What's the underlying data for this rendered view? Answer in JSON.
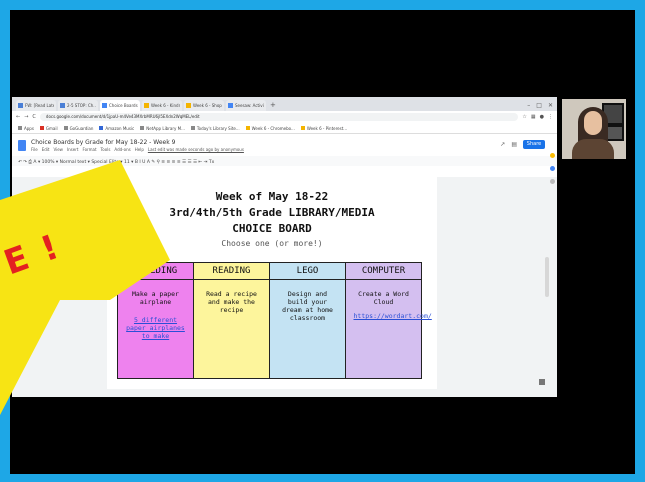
{
  "tabs": [
    {
      "label": "FW: [Read Later] Fw...",
      "active": false,
      "icon": "mail-icon"
    },
    {
      "label": "2-5 STOP: Ch...",
      "active": false,
      "icon": "doc-icon"
    },
    {
      "label": "Choice Boards by Gra...",
      "active": true,
      "icon": "docs-icon"
    },
    {
      "label": "Week 6 - Kindness Cl...",
      "active": false,
      "icon": "folder-icon"
    },
    {
      "label": "Week 6 - Shop the Li...",
      "active": false,
      "icon": "folder-icon"
    },
    {
      "label": "Seesaw: Activity Libr...",
      "active": false,
      "icon": "docs-icon"
    }
  ],
  "address": {
    "url": "docs.google.com/document/d/1jpaU-m4Ve43MXrbMRU6jI5EXdn2WqMEL/edit",
    "nav_back": "←",
    "nav_forward": "→",
    "reload": "C"
  },
  "bookmarks": [
    {
      "label": "Apps"
    },
    {
      "label": "Gmail"
    },
    {
      "label": "GoGuardian"
    },
    {
      "label": "Amazon Music"
    },
    {
      "label": "NetApp Library M..."
    },
    {
      "label": "Today's Library Site..."
    },
    {
      "label": "Week 6 - Chromebo..."
    },
    {
      "label": "Week 6 - Pinterest..."
    }
  ],
  "doc": {
    "title": "Choice Boards by Grade for May 18-22 - Week 9",
    "menus": [
      "File",
      "Edit",
      "View",
      "Insert",
      "Format",
      "Tools",
      "Add-ons",
      "Help"
    ],
    "last_edit": "Last edit was made seconds ago by anonymous",
    "share_label": "Share",
    "toolbar": "↶ ↷ ⎙ A ▾ 100% ▾  Normal text ▾  Special Elite ▾  11 ▾  B I U A ✎  ⚲ ≡ ≡ ≡ ≡  ☰ ☰ ☰  ⇤ ⇥  Tx",
    "heading_line1": "Week of May 18-22",
    "heading_line2": "3rd/4th/5th Grade LIBRARY/MEDIA",
    "heading_line3": "CHOICE BOARD",
    "subtitle": "Choose one (or more!)",
    "table": {
      "headers": [
        "BUILDING",
        "READING",
        "LEGO",
        "COMPUTER"
      ],
      "cells": [
        {
          "text": "Make a paper airplane",
          "link": "5 different paper airplanes to make"
        },
        {
          "text": "Read a recipe and make the recipe",
          "link": ""
        },
        {
          "text": "Design and build your dream at home classroom",
          "link": ""
        },
        {
          "text": "Create a Word Cloud",
          "link": "https://wordart.com/"
        }
      ]
    }
  },
  "overlay": {
    "text": "E !"
  },
  "colors": {
    "outer_border": "#1ea7e6",
    "building": "#ee82ee",
    "reading": "#fdf59c",
    "lego": "#c4e3f3",
    "computer": "#d4bff0",
    "burst": "#f7e414"
  }
}
